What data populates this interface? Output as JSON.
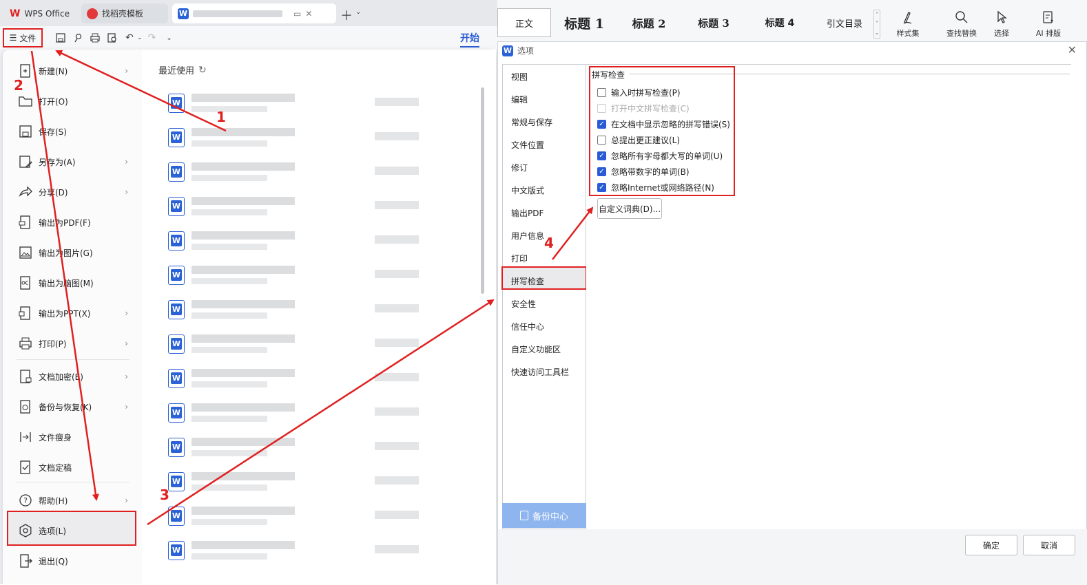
{
  "tabs": {
    "wps": "WPS Office",
    "template": "找稻壳模板"
  },
  "toolbar": {
    "file_label": "文件",
    "start_tab": "开始"
  },
  "menu": {
    "items": [
      {
        "label": "新建(N)",
        "icon": "new-doc-icon",
        "chevron": true
      },
      {
        "label": "打开(O)",
        "icon": "folder-icon",
        "chevron": false
      },
      {
        "label": "保存(S)",
        "icon": "save-icon",
        "chevron": false
      },
      {
        "label": "另存为(A)",
        "icon": "save-as-icon",
        "chevron": true
      },
      {
        "label": "分享(D)",
        "icon": "share-icon",
        "chevron": true
      },
      {
        "label": "输出为PDF(F)",
        "icon": "pdf-icon",
        "chevron": false
      },
      {
        "label": "输出为图片(G)",
        "icon": "image-icon",
        "chevron": false
      },
      {
        "label": "输出为脑图(M)",
        "icon": "mindmap-icon",
        "chevron": false
      },
      {
        "label": "输出为PPT(X)",
        "icon": "ppt-icon",
        "chevron": true
      },
      {
        "label": "打印(P)",
        "icon": "printer-icon",
        "chevron": true
      },
      {
        "label": "文档加密(E)",
        "icon": "lock-doc-icon",
        "chevron": true
      },
      {
        "label": "备份与恢复(K)",
        "icon": "backup-icon",
        "chevron": true
      },
      {
        "label": "文件瘦身",
        "icon": "slim-icon",
        "chevron": false
      },
      {
        "label": "文档定稿",
        "icon": "finalize-icon",
        "chevron": false
      },
      {
        "label": "帮助(H)",
        "icon": "help-icon",
        "chevron": true
      },
      {
        "label": "选项(L)",
        "icon": "gear-icon",
        "chevron": false
      },
      {
        "label": "退出(Q)",
        "icon": "exit-icon",
        "chevron": false
      }
    ]
  },
  "recent": {
    "title": "最近使用"
  },
  "ribbon": {
    "styles": [
      "正文",
      "标题 1",
      "标题 2",
      "标题 3",
      "标题 4",
      "引文目录"
    ],
    "buttons": [
      "样式集",
      "查找替换",
      "选择",
      "AI 排版"
    ]
  },
  "dialog": {
    "title": "选项",
    "nav": [
      "视图",
      "编辑",
      "常规与保存",
      "文件位置",
      "修订",
      "中文版式",
      "输出PDF",
      "用户信息",
      "打印",
      "拼写检查",
      "安全性",
      "信任中心",
      "自定义功能区",
      "快速访问工具栏"
    ],
    "selected_nav": "拼写检查",
    "group_title": "拼写检查",
    "options": [
      {
        "label": "输入时拼写检查(P)",
        "checked": false,
        "disabled": false
      },
      {
        "label": "打开中文拼写检查(C)",
        "checked": false,
        "disabled": true
      },
      {
        "label": "在文档中显示忽略的拼写错误(S)",
        "checked": true,
        "disabled": false
      },
      {
        "label": "总提出更正建议(L)",
        "checked": false,
        "disabled": false
      },
      {
        "label": "忽略所有字母都大写的单词(U)",
        "checked": true,
        "disabled": false
      },
      {
        "label": "忽略带数字的单词(B)",
        "checked": true,
        "disabled": false
      },
      {
        "label": "忽略Internet或网络路径(N)",
        "checked": true,
        "disabled": false
      }
    ],
    "dict_button": "自定义词典(D)...",
    "backup_center": "备份中心",
    "ok": "确定",
    "cancel": "取消"
  },
  "annotations": {
    "steps": [
      "1",
      "2",
      "3",
      "4"
    ],
    "color": "#e02020"
  }
}
